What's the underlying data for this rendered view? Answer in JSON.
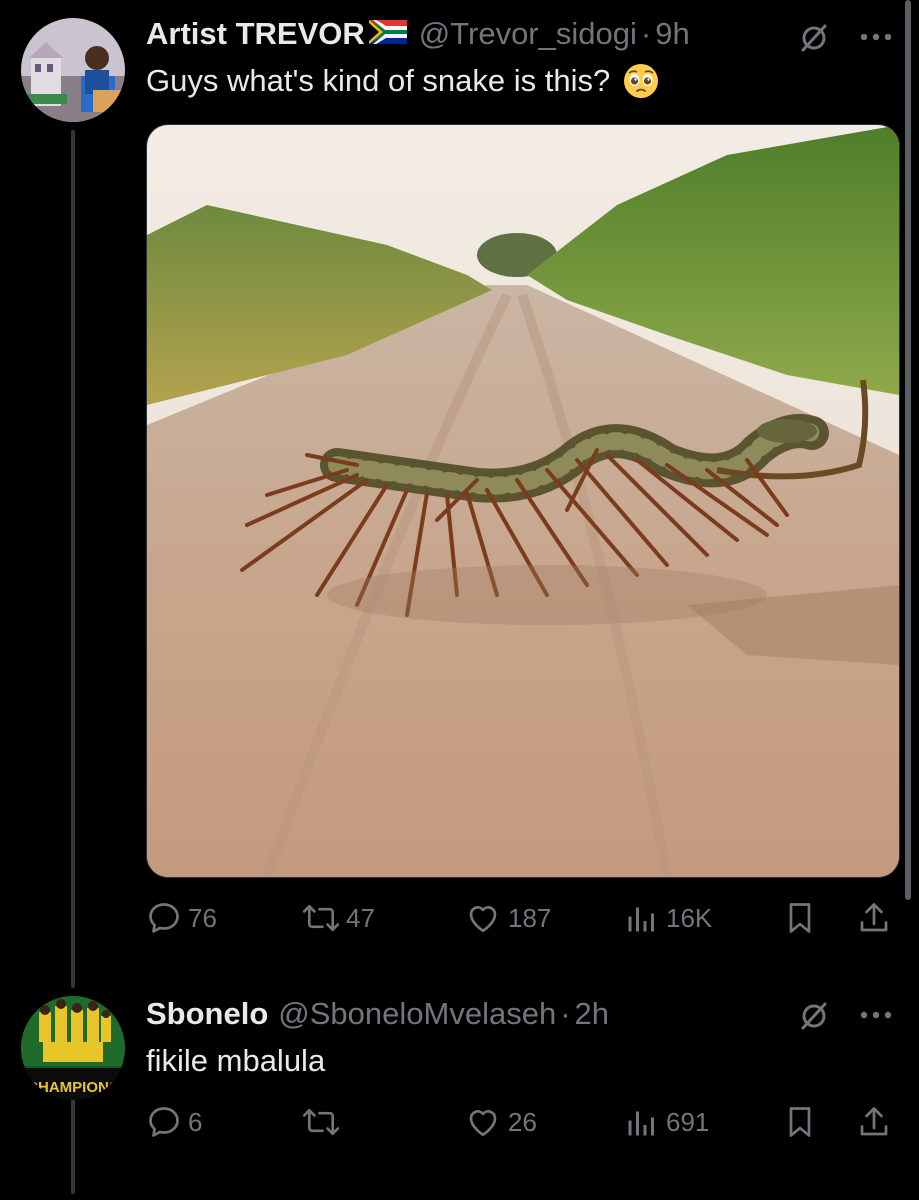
{
  "tweet": {
    "display_name": "Artist TREVOR",
    "flag_icon": "south-africa-flag",
    "handle": "@Trevor_sidogi",
    "separator": "·",
    "time": "9h",
    "text": "Guys what's kind of snake is this?",
    "emoji_icon": "pleading-face-emoji",
    "media_description_icon": "snake-centipede-photo",
    "stats": {
      "replies": "76",
      "reposts": "47",
      "likes": "187",
      "views": "16K"
    }
  },
  "reply": {
    "display_name": "Sbonelo",
    "handle": "@SboneloMvelaseh",
    "separator": "·",
    "time": "2h",
    "text": "fikile mbalula",
    "avatar_text": "CHAMPIONS",
    "stats": {
      "replies": "6",
      "reposts": "",
      "likes": "26",
      "views": "691"
    }
  },
  "colors": {
    "background": "#000000",
    "text_primary": "#e7e9ea",
    "text_secondary": "#71767b",
    "thread_line": "#333639"
  }
}
